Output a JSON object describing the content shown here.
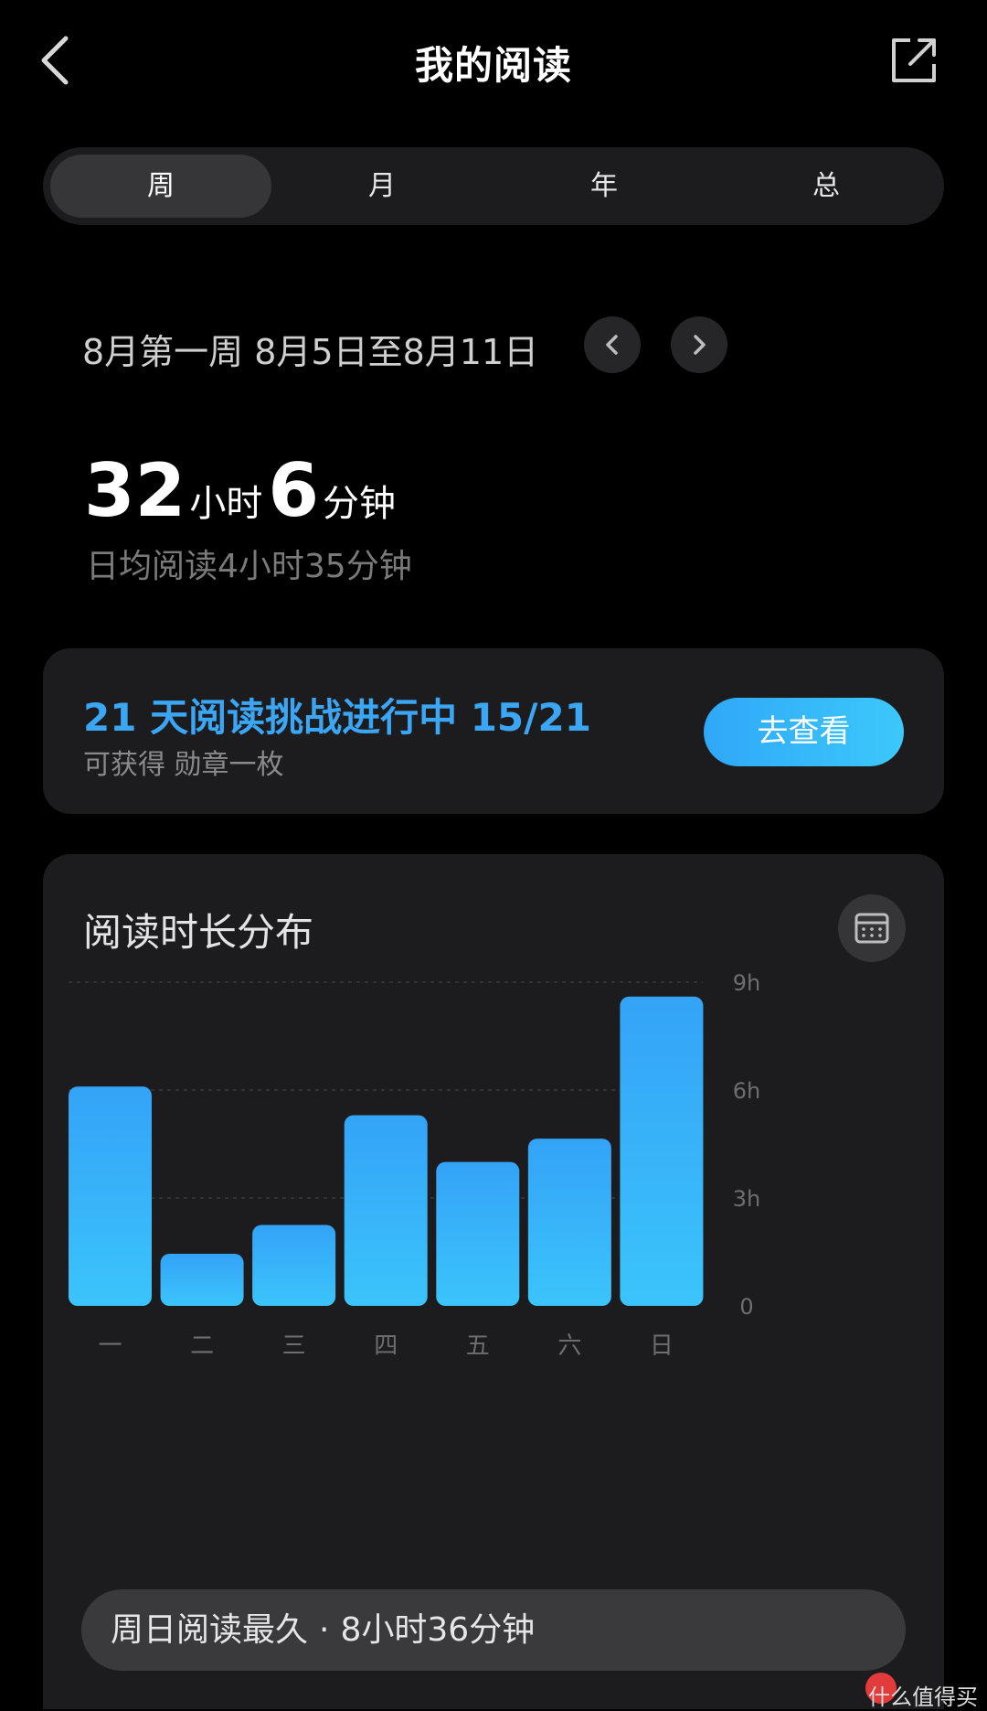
{
  "header": {
    "title": "我的阅读",
    "back_icon": "chevron-left-icon",
    "share_icon": "share-external-icon"
  },
  "tabs": [
    {
      "label": "周",
      "active": true
    },
    {
      "label": "月",
      "active": false
    },
    {
      "label": "年",
      "active": false
    },
    {
      "label": "总",
      "active": false
    }
  ],
  "week": {
    "label": "8月第一周 8月5日至8月11日",
    "prev_icon": "chevron-left-icon",
    "next_icon": "chevron-right-icon"
  },
  "totals": {
    "hours": "32",
    "hours_unit": "小时",
    "minutes": "6",
    "minutes_unit": "分钟",
    "daily_average": "日均阅读4小时35分钟"
  },
  "challenge": {
    "title": "21 天阅读挑战进行中 15/21",
    "subtitle": "可获得 勋章一枚",
    "button": "去查看",
    "accent": "#3aa6f4"
  },
  "distribution": {
    "title": "阅读时长分布",
    "calendar_icon": "calendar-icon",
    "summary_lead": "周日阅读最久",
    "summary_sep": "·",
    "summary_value": "8小时36分钟"
  },
  "chart_data": {
    "type": "bar",
    "categories": [
      "一",
      "二",
      "三",
      "四",
      "五",
      "六",
      "日"
    ],
    "values": [
      6.1,
      1.45,
      2.25,
      5.3,
      4.0,
      4.65,
      8.6
    ],
    "y_ticks": [
      "0",
      "3h",
      "6h",
      "9h"
    ],
    "y_tick_values": [
      0,
      3,
      6,
      9
    ],
    "ylim": [
      0,
      9
    ],
    "unit": "h",
    "grid": true,
    "bar_color_top": "#34a3f7",
    "bar_color_bottom": "#3bc4fb"
  },
  "watermark": "什么值得买"
}
